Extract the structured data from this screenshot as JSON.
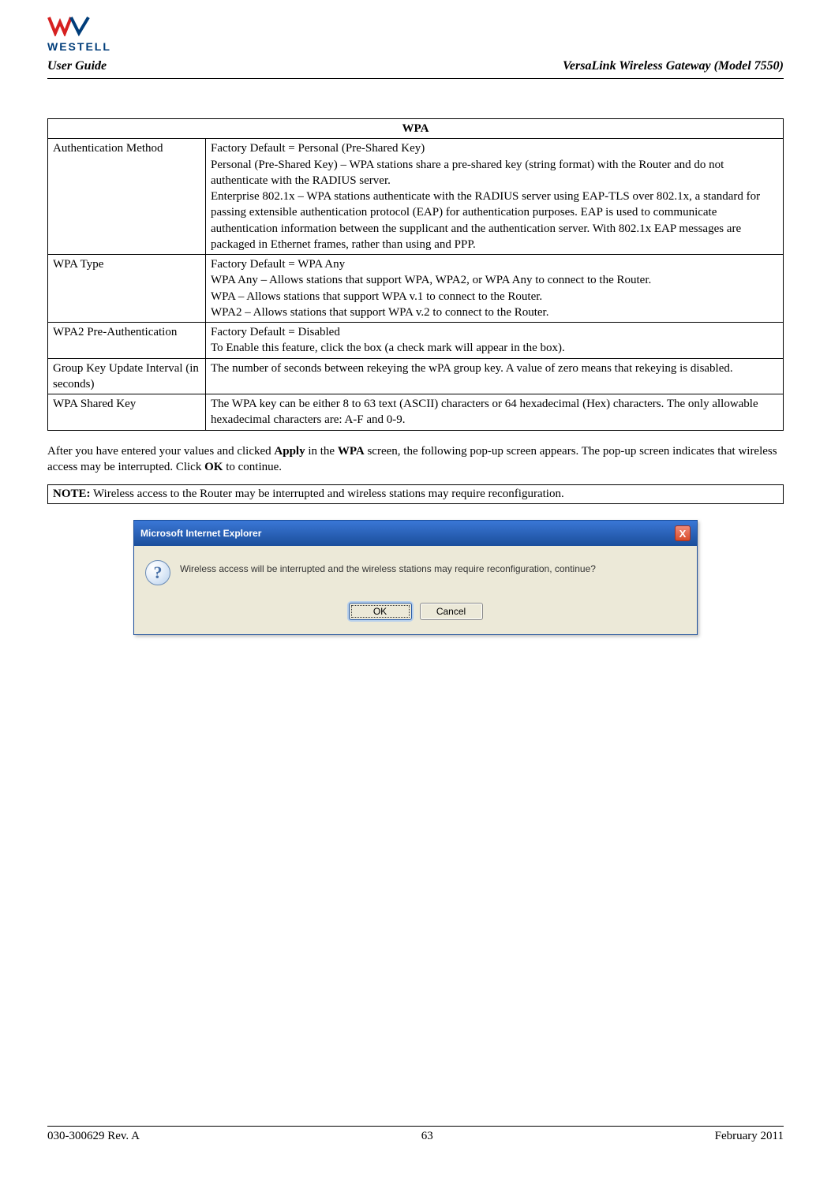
{
  "logo_text": "WESTELL",
  "header": {
    "left": "User Guide",
    "right": "VersaLink Wireless Gateway (Model 7550)"
  },
  "table": {
    "title": "WPA",
    "rows": [
      {
        "label": "Authentication Method",
        "value": "Factory Default = Personal (Pre-Shared Key)\nPersonal (Pre-Shared Key) – WPA stations share a pre-shared key (string format) with the Router and do not authenticate with the RADIUS server.\nEnterprise 802.1x – WPA stations authenticate with the RADIUS server using EAP-TLS over 802.1x, a standard for passing extensible authentication protocol (EAP) for authentication purposes. EAP is used to communicate authentication information between the supplicant and the authentication server. With 802.1x EAP messages are packaged in Ethernet frames, rather than using and PPP."
      },
      {
        "label": "WPA Type",
        "value": "Factory Default = WPA Any\nWPA Any – Allows stations that support WPA, WPA2, or WPA Any to connect to the Router.\nWPA – Allows stations that support WPA v.1 to connect to the Router.\nWPA2 – Allows stations that support WPA v.2 to connect to the Router."
      },
      {
        "label": "WPA2 Pre-Authentication",
        "value": "Factory Default = Disabled\nTo Enable this feature, click the box (a check mark will appear in the box)."
      },
      {
        "label": "Group Key Update Interval (in seconds)",
        "value": "The number of seconds between rekeying the wPA group key. A value of zero means that rekeying is disabled."
      },
      {
        "label": "WPA Shared Key",
        "value": "The WPA key can be either 8 to 63 text (ASCII) characters or 64 hexadecimal (Hex) characters. The only allowable hexadecimal characters are: A-F and 0-9."
      }
    ]
  },
  "paragraph": {
    "pre": "After you have entered your values and clicked ",
    "b1": "Apply",
    "mid1": " in the ",
    "b2": "WPA",
    "mid2": " screen, the following pop-up screen appears. The pop-up screen indicates that wireless access may be interrupted. Click ",
    "b3": "OK",
    "post": " to continue."
  },
  "note": {
    "label": "NOTE:",
    "text": " Wireless access to the Router may be interrupted and wireless stations may require reconfiguration."
  },
  "dialog": {
    "title": "Microsoft Internet Explorer",
    "message": "Wireless access will be interrupted and the wireless stations may require reconfiguration, continue?",
    "ok": "OK",
    "cancel": "Cancel",
    "close": "X",
    "icon": "?"
  },
  "footer": {
    "left": "030-300629 Rev. A",
    "center": "63",
    "right": "February 2011"
  }
}
